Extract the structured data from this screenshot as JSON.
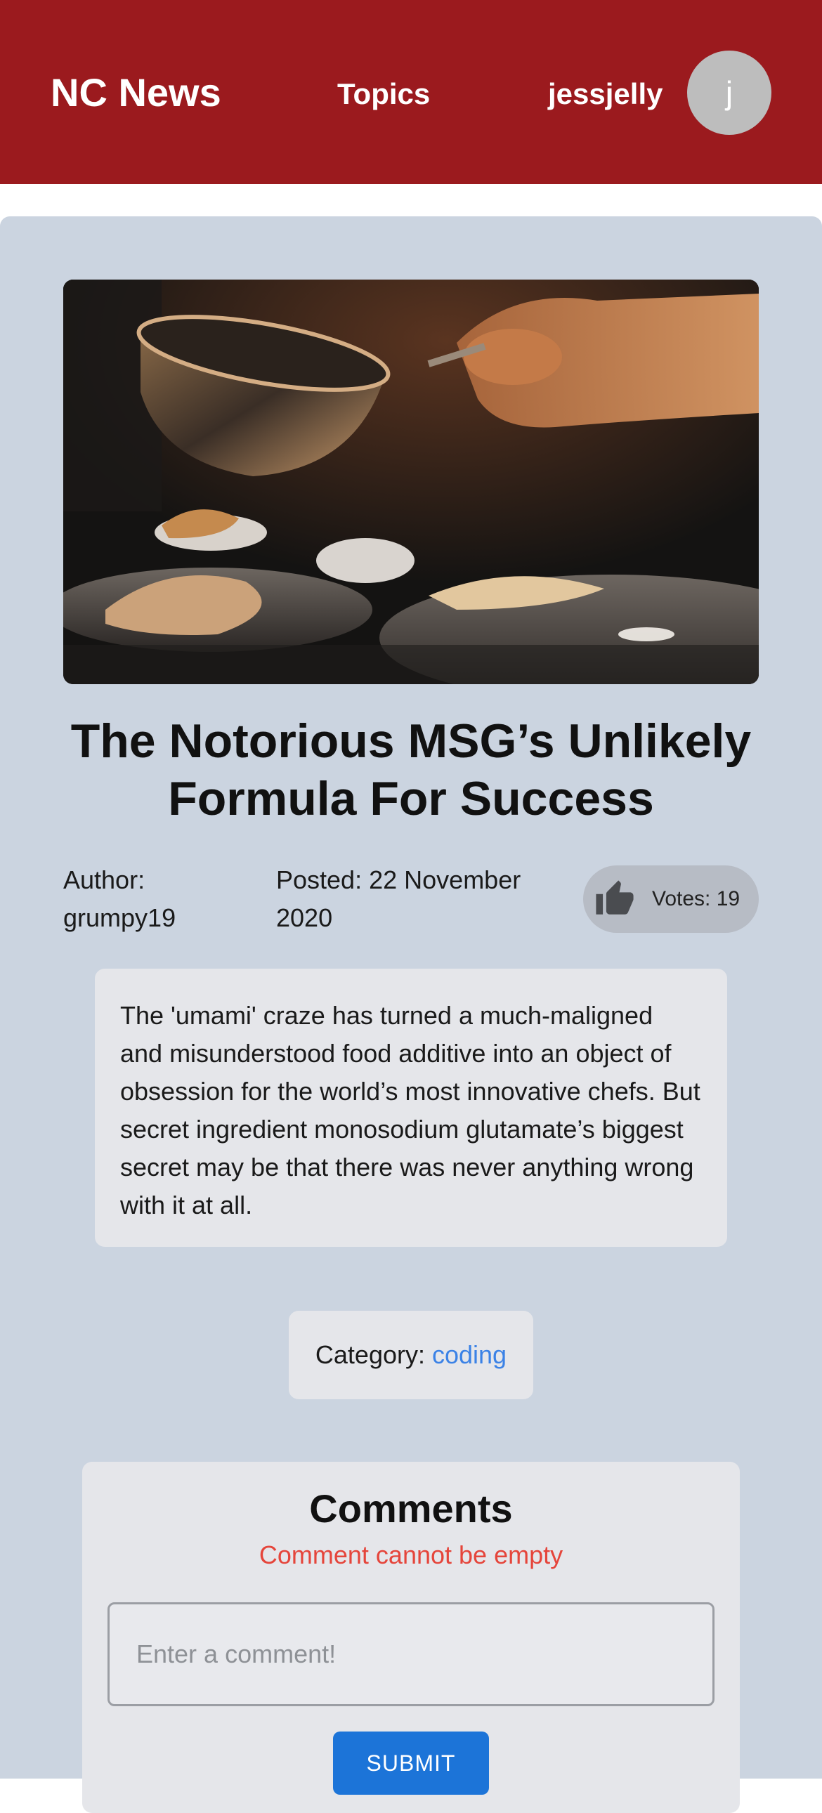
{
  "header": {
    "brand": "NC News",
    "nav_topics": "Topics",
    "username": "jessjelly",
    "avatar_initial": "j",
    "background_color": "#9b1a1e"
  },
  "article": {
    "title": "The Notorious MSG’s Unlikely Formula For Success",
    "author_label": "Author:",
    "author": "grumpy19",
    "posted_label": "Posted:",
    "posted_date": "22 November 2020",
    "votes_label": "Votes:",
    "votes": 19,
    "vote_icon": "thumbs-up-icon",
    "body": "The 'umami' craze has turned a much-maligned and misunderstood food additive into an object of obsession for the world’s most innovative chefs. But secret ingredient monosodium glutamate’s biggest secret may be that there was never anything wrong with it at all.",
    "category_label": "Category:",
    "category": "coding",
    "category_link_color": "#3b82e6"
  },
  "comments": {
    "heading": "Comments",
    "error": "Comment cannot be empty",
    "input_value": "",
    "input_placeholder": "Enter a comment!",
    "submit_label": "SUBMIT",
    "submit_color": "#1c74d8",
    "error_color": "#e5453b"
  }
}
